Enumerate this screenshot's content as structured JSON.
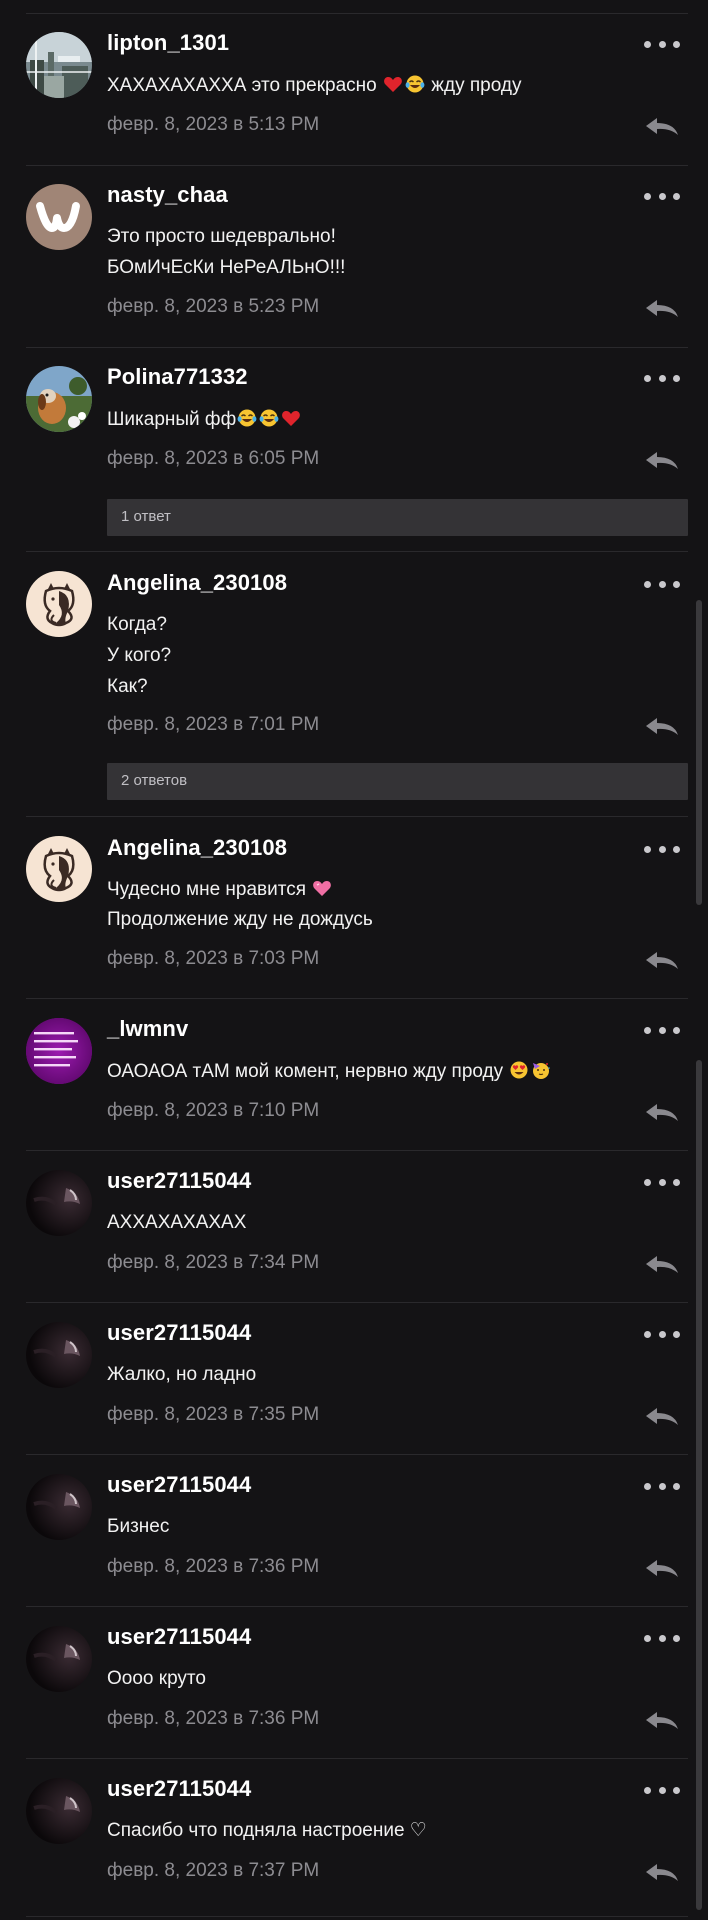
{
  "comments": [
    {
      "username": "lipton_1301",
      "avatar_icon": "landscape-avatar-icon",
      "lines": [
        {
          "pre": "ХАХАХАХАХХА это прекрасно ",
          "emojis": [
            "heart-icon",
            "tears-of-joy-icon"
          ],
          "post": " жду проду"
        }
      ],
      "timestamp": "февр. 8, 2023 в 5:13 PM",
      "replies": null
    },
    {
      "username": "nasty_chaa",
      "avatar_icon": "wattpad-logo-avatar-icon",
      "lines": [
        {
          "pre": "Это просто шедеврально!",
          "emojis": [],
          "post": ""
        },
        {
          "pre": "БОмИчЕсКи НеРеАЛЬнО!!!",
          "emojis": [],
          "post": ""
        }
      ],
      "timestamp": "февр. 8, 2023 в 5:23 PM",
      "replies": null
    },
    {
      "username": "Polina771332",
      "avatar_icon": "dog-photo-avatar-icon",
      "lines": [
        {
          "pre": "Шикарный фф",
          "emojis": [
            "tears-of-joy-icon",
            "tears-of-joy-icon",
            "heart-icon"
          ],
          "post": ""
        }
      ],
      "timestamp": "февр. 8, 2023 в 6:05 PM",
      "replies": "1 ответ"
    },
    {
      "username": "Angelina_230108",
      "avatar_icon": "cats-drawing-avatar-icon",
      "lines": [
        {
          "pre": "Когда?",
          "emojis": [],
          "post": ""
        },
        {
          "pre": "У кого?",
          "emojis": [],
          "post": ""
        },
        {
          "pre": "Как?",
          "emojis": [],
          "post": ""
        }
      ],
      "timestamp": "февр. 8, 2023 в 7:01 PM",
      "replies": "2 ответов"
    },
    {
      "username": "Angelina_230108",
      "avatar_icon": "cats-drawing-avatar-icon",
      "lines": [
        {
          "pre": "Чудесно мне нравится ",
          "emojis": [
            "pink-heart-icon"
          ],
          "post": ""
        },
        {
          "pre": "Продолжение жду не дождусь",
          "emojis": [],
          "post": ""
        }
      ],
      "timestamp": "февр. 8, 2023 в 7:03 PM",
      "replies": null
    },
    {
      "username": "_lwmnv",
      "avatar_icon": "purple-schedule-avatar-icon",
      "lines": [
        {
          "pre": "ОАОАОА тАМ мой комент, нервно жду проду ",
          "emojis": [
            "heart-eyes-icon",
            "party-face-icon"
          ],
          "post": ""
        }
      ],
      "timestamp": "февр. 8, 2023 в 7:10 PM",
      "replies": null
    },
    {
      "username": "user27115044",
      "avatar_icon": "dark-photo-avatar-icon",
      "lines": [
        {
          "pre": "АХХАХАХАХАХ",
          "emojis": [],
          "post": ""
        }
      ],
      "timestamp": "февр. 8, 2023 в 7:34 PM",
      "replies": null
    },
    {
      "username": "user27115044",
      "avatar_icon": "dark-photo-avatar-icon",
      "lines": [
        {
          "pre": "Жалко, но ладно",
          "emojis": [],
          "post": ""
        }
      ],
      "timestamp": "февр. 8, 2023 в 7:35 PM",
      "replies": null
    },
    {
      "username": "user27115044",
      "avatar_icon": "dark-photo-avatar-icon",
      "lines": [
        {
          "pre": "Бизнес",
          "emojis": [],
          "post": ""
        }
      ],
      "timestamp": "февр. 8, 2023 в 7:36 PM",
      "replies": null
    },
    {
      "username": "user27115044",
      "avatar_icon": "dark-photo-avatar-icon",
      "lines": [
        {
          "pre": "Оооо круто",
          "emojis": [],
          "post": ""
        }
      ],
      "timestamp": "февр. 8, 2023 в 7:36 PM",
      "replies": null
    },
    {
      "username": "user27115044",
      "avatar_icon": "dark-photo-avatar-icon",
      "lines": [
        {
          "pre": "Спасибо что подняла настроение ♡",
          "emojis": [],
          "post": ""
        }
      ],
      "timestamp": "февр. 8, 2023 в 7:37 PM",
      "replies": null
    }
  ],
  "icons": {
    "more": "more-options-icon",
    "reply": "reply-arrow-icon"
  },
  "colors": {
    "background": "#141315",
    "divider": "#2a292c",
    "timestamp": "#8d8c91",
    "replies_bar": "#343336"
  }
}
